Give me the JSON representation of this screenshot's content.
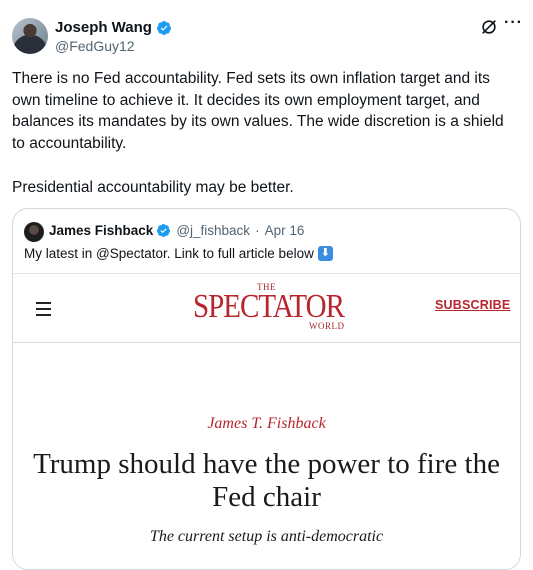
{
  "author": {
    "name": "Joseph Wang",
    "handle": "@FedGuy12",
    "verified": true
  },
  "header_actions": {
    "grok_icon": "grok-icon",
    "more_label": "···"
  },
  "tweet": {
    "paragraph1": "There is no Fed accountability. Fed sets its own inflation target and its own timeline to achieve it. It decides its own employment target, and balances its mandates by its own values. The wide discretion is a shield to accountability.",
    "paragraph2": "Presidential accountability may be better."
  },
  "quoted_tweet": {
    "name": "James Fishback",
    "handle": "@j_fishback",
    "separator": "·",
    "date": "Apr 16",
    "text": "My latest in @Spectator. Link to full article below",
    "emoji": "⬇"
  },
  "article_card": {
    "menu_icon": "hamburger-menu-icon",
    "logo_the": "THE",
    "logo_main": "SPECTATOR",
    "logo_world": "WORLD",
    "subscribe_label": "SUBSCRIBE",
    "author": "James T. Fishback",
    "headline": "Trump should have the power to fire the Fed chair",
    "subhead": "The current setup is anti-democratic"
  },
  "colors": {
    "verified_blue": "#1d9bf0",
    "spectator_red": "#b8252c",
    "handle_gray": "#536471",
    "border": "#cfd9de"
  }
}
